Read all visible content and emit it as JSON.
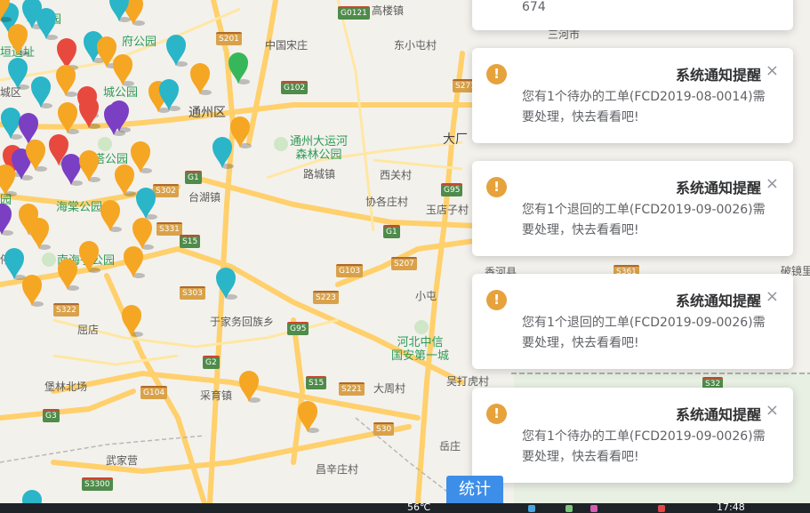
{
  "map": {
    "labels": {
      "gaoyang": "高楼镇",
      "zhongguosong": "中国宋庄",
      "dongxiaotun": "东小屯村",
      "sanhe": "三河市",
      "tongzhou": "通州区",
      "canal_park": "通州大运河\n森林公园",
      "luchengzhen": "路城镇",
      "xiguan": "西关村",
      "dachang": "大厂",
      "taihu": "台湖镇",
      "xiegezhuang": "协各庄村",
      "yudian": "玉店子村",
      "xianghe": "香河县",
      "xiaotun": "小屯",
      "yujiawu": "于家务回族乡",
      "hebei_park": "河北中信\n国安第一城",
      "qudian": "屈店",
      "caiyu": "采育镇",
      "dazhou": "大周村",
      "wuhui": "吴打虎村",
      "pu_linchang": "堡林北场",
      "wujiaying": "武家营",
      "yueyang": "岳庄",
      "changxing": "昌辛庄村",
      "gu_pagoda": "古塔公园",
      "haitang": "海棠公园",
      "yuan_site": "垣遗址",
      "park_n": "府公园",
      "park_c": "城公园",
      "chengqu": "城区",
      "yuan_park": "园",
      "poshang": "破镜里",
      "ting": "停",
      "nanhai": "南海子公园",
      "small_park": "小公园"
    },
    "roads": [
      "G0121",
      "S201",
      "G102",
      "S271",
      "G1",
      "S302",
      "G95",
      "S331",
      "S15",
      "G1",
      "G103",
      "S207",
      "S303",
      "S223",
      "S322",
      "G95",
      "G2",
      "G104",
      "S15",
      "S221",
      "S30",
      "G3",
      "S3300",
      "S32",
      "S361",
      "S322"
    ]
  },
  "notifications": [
    {
      "title": "",
      "message": "674",
      "partial": true
    },
    {
      "title": "系统通知提醒",
      "message": "您有1个待办的工单(FCD2019-08-0014)需要处理，快去看看吧!"
    },
    {
      "title": "系统通知提醒",
      "message": "您有1个退回的工单(FCD2019-09-0026)需要处理，快去看看吧!"
    },
    {
      "title": "系统通知提醒",
      "message": "您有1个退回的工单(FCD2019-09-0026)需要处理，快去看看吧!"
    },
    {
      "title": "系统通知提醒",
      "message": "您有1个待办的工单(FCD2019-09-0026)需要处理，快去看看吧!"
    }
  ],
  "icons": {
    "warning": "!",
    "close": "×"
  },
  "stat_button": "统计",
  "taskbar": {
    "temperature": "56℃",
    "clock": "17:48"
  },
  "colors": {
    "warning": "#e6a23c",
    "orange_pin": "#f5a623",
    "cyan_pin": "#2ab5c8",
    "purple_pin": "#7b3fc4",
    "red_pin": "#e8493f",
    "green_pin": "#36b85a"
  }
}
